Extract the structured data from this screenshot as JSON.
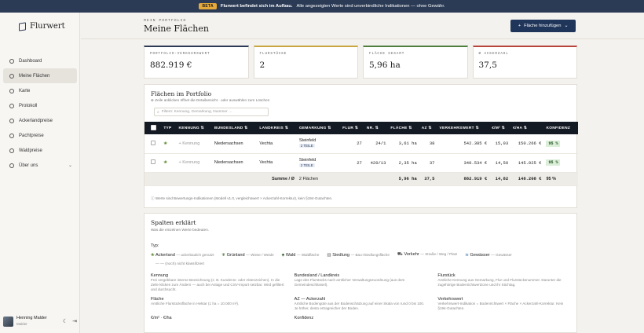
{
  "banner": {
    "badge": "BETA",
    "strong": "Flurwert befindet sich im Aufbau.",
    "text": "Alle angezeigten Werte sind unverbindliche Indikationen — ohne Gewähr."
  },
  "sidebar": {
    "brand": "Flurwert",
    "items": [
      {
        "label": "Dashboard"
      },
      {
        "label": "Meine Flächen"
      },
      {
        "label": "Karte"
      },
      {
        "label": "Protokoll"
      },
      {
        "label": "Ackerlandpreise"
      },
      {
        "label": "Pachtpreise"
      },
      {
        "label": "Waldpreise"
      },
      {
        "label": "Über uns"
      }
    ],
    "user": {
      "name": "Henning Malder",
      "role": "Makler"
    }
  },
  "header": {
    "eyebrow": "MEIN PORTFOLIO",
    "title": "Meine Flächen",
    "add_button": "Fläche hinzufügen"
  },
  "kpis": [
    {
      "label": "PORTFOLIO-VERKEHRSWERT",
      "value": "882.919 €"
    },
    {
      "label": "FLURSTÜCKE",
      "value": "2"
    },
    {
      "label": "FLÄCHE GESAMT",
      "value": "5,96 ha"
    },
    {
      "label": "Ø ACKERZAHL",
      "value": "37,5"
    }
  ],
  "portfolio": {
    "title": "Flächen im Portfolio",
    "hint": "Zeile anklicken öffnet die Detailansicht · oder auswählen zum Löschen",
    "search_placeholder": "Filtern: Kennung, Gemarkung, Nummer …",
    "columns": [
      "TYP",
      "KENNUNG",
      "BUNDESLAND",
      "LANDKREIS",
      "GEMARKUNG",
      "FLUR",
      "NR.",
      "FLÄCHE",
      "AZ",
      "VERKEHRSWERT",
      "€/M²",
      "€/HA",
      "KONFIDENZ"
    ],
    "rows": [
      {
        "kennung": "+ Kennung",
        "bundesland": "Niedersachsen",
        "landkreis": "Vechta",
        "gemarkung": "Steinfeld",
        "teile": "2 TEILE",
        "flur": "27",
        "nr": "24/1",
        "flaeche": "3,61 ha",
        "az": "38",
        "verkehrswert": "542.385 €",
        "eur_m2": "15,03",
        "eur_ha": "150.266 €",
        "konfidenz": "95 %"
      },
      {
        "kennung": "+ Kennung",
        "bundesland": "Niedersachsen",
        "landkreis": "Vechta",
        "gemarkung": "Steinfeld",
        "teile": "2 TEILE",
        "flur": "27",
        "nr": "420/13",
        "flaeche": "2,35 ha",
        "az": "37",
        "verkehrswert": "340.534 €",
        "eur_m2": "14,50",
        "eur_ha": "145.025 €",
        "konfidenz": "95 %"
      }
    ],
    "sum": {
      "label": "Summe / Ø",
      "count": "2 Flächen",
      "flaeche": "5,96 ha",
      "az": "37,5",
      "verkehrswert": "882.919 €",
      "eur_m2": "14,82",
      "eur_ha": "148.208 €",
      "konfidenz": "95 %"
    },
    "note": "Werte sind Bewertungs-Indikationen (Modell v1.0, vergleichswert × Ackerzahl-Korrektur), kein §194-Gutachten."
  },
  "legend": {
    "title": "Spalten erklärt",
    "subtitle": "Was die einzelnen Werte bedeuten.",
    "type_label": "Typ:",
    "types": [
      {
        "name": "Ackerland",
        "desc": "— ackerbaulich genutzt"
      },
      {
        "name": "Grünland",
        "desc": "— Wiese / Weide"
      },
      {
        "name": "Wald",
        "desc": "— Waldfläche"
      },
      {
        "name": "Siedlung",
        "desc": "— Bau-/Siedlungsfläche"
      },
      {
        "name": "Verkehr",
        "desc": "— Straße / Weg / Platz"
      },
      {
        "name": "Gewässer",
        "desc": "— Gewässer"
      }
    ],
    "unknown": "— — (noch) nicht klassifiziert",
    "items": [
      {
        "h": "Kennung",
        "d": "Frei vergebbare interne Bezeichnung (z. B. Kundennr. oder Aktenzeichen). In die Zeile klicken zum Ändern — auch bei Anlage und CSV-Import setzbar. Wird gefiltert und durchsucht."
      },
      {
        "h": "Bundesland / Landkreis",
        "d": "Lage des Flurstücks nach amtlicher Verwaltungszuordnung (aus dem Gemeindeschlüssel)."
      },
      {
        "h": "Flurstück",
        "d": "Amtliche Kennung aus Gemarkung, Flur und Flurstücksnummer. Darunter die zugehörige Bodenrichtwertzone und ihr Stichtag."
      },
      {
        "h": "Fläche",
        "d": "Amtliche Flurstücksfläche in Hektar (1 ha = 10.000 m²)."
      },
      {
        "h": "AZ — Ackerzahl",
        "d": "Amtliche Bodengüte aus der Bodenschätzung auf einer Skala von rund 0 bis 100. Je höher, desto ertragreicher der Boden."
      },
      {
        "h": "Verkehrswert",
        "d": "Verkehrswert-Indikation = Bodenrichtwert × Fläche × Ackerzahl-Korrektur. Kein §194-Gutachten."
      },
      {
        "h": "€/m² · €/ha",
        "d": ""
      },
      {
        "h": "Konfidenz",
        "d": ""
      },
      {
        "h": "",
        "d": ""
      }
    ]
  }
}
